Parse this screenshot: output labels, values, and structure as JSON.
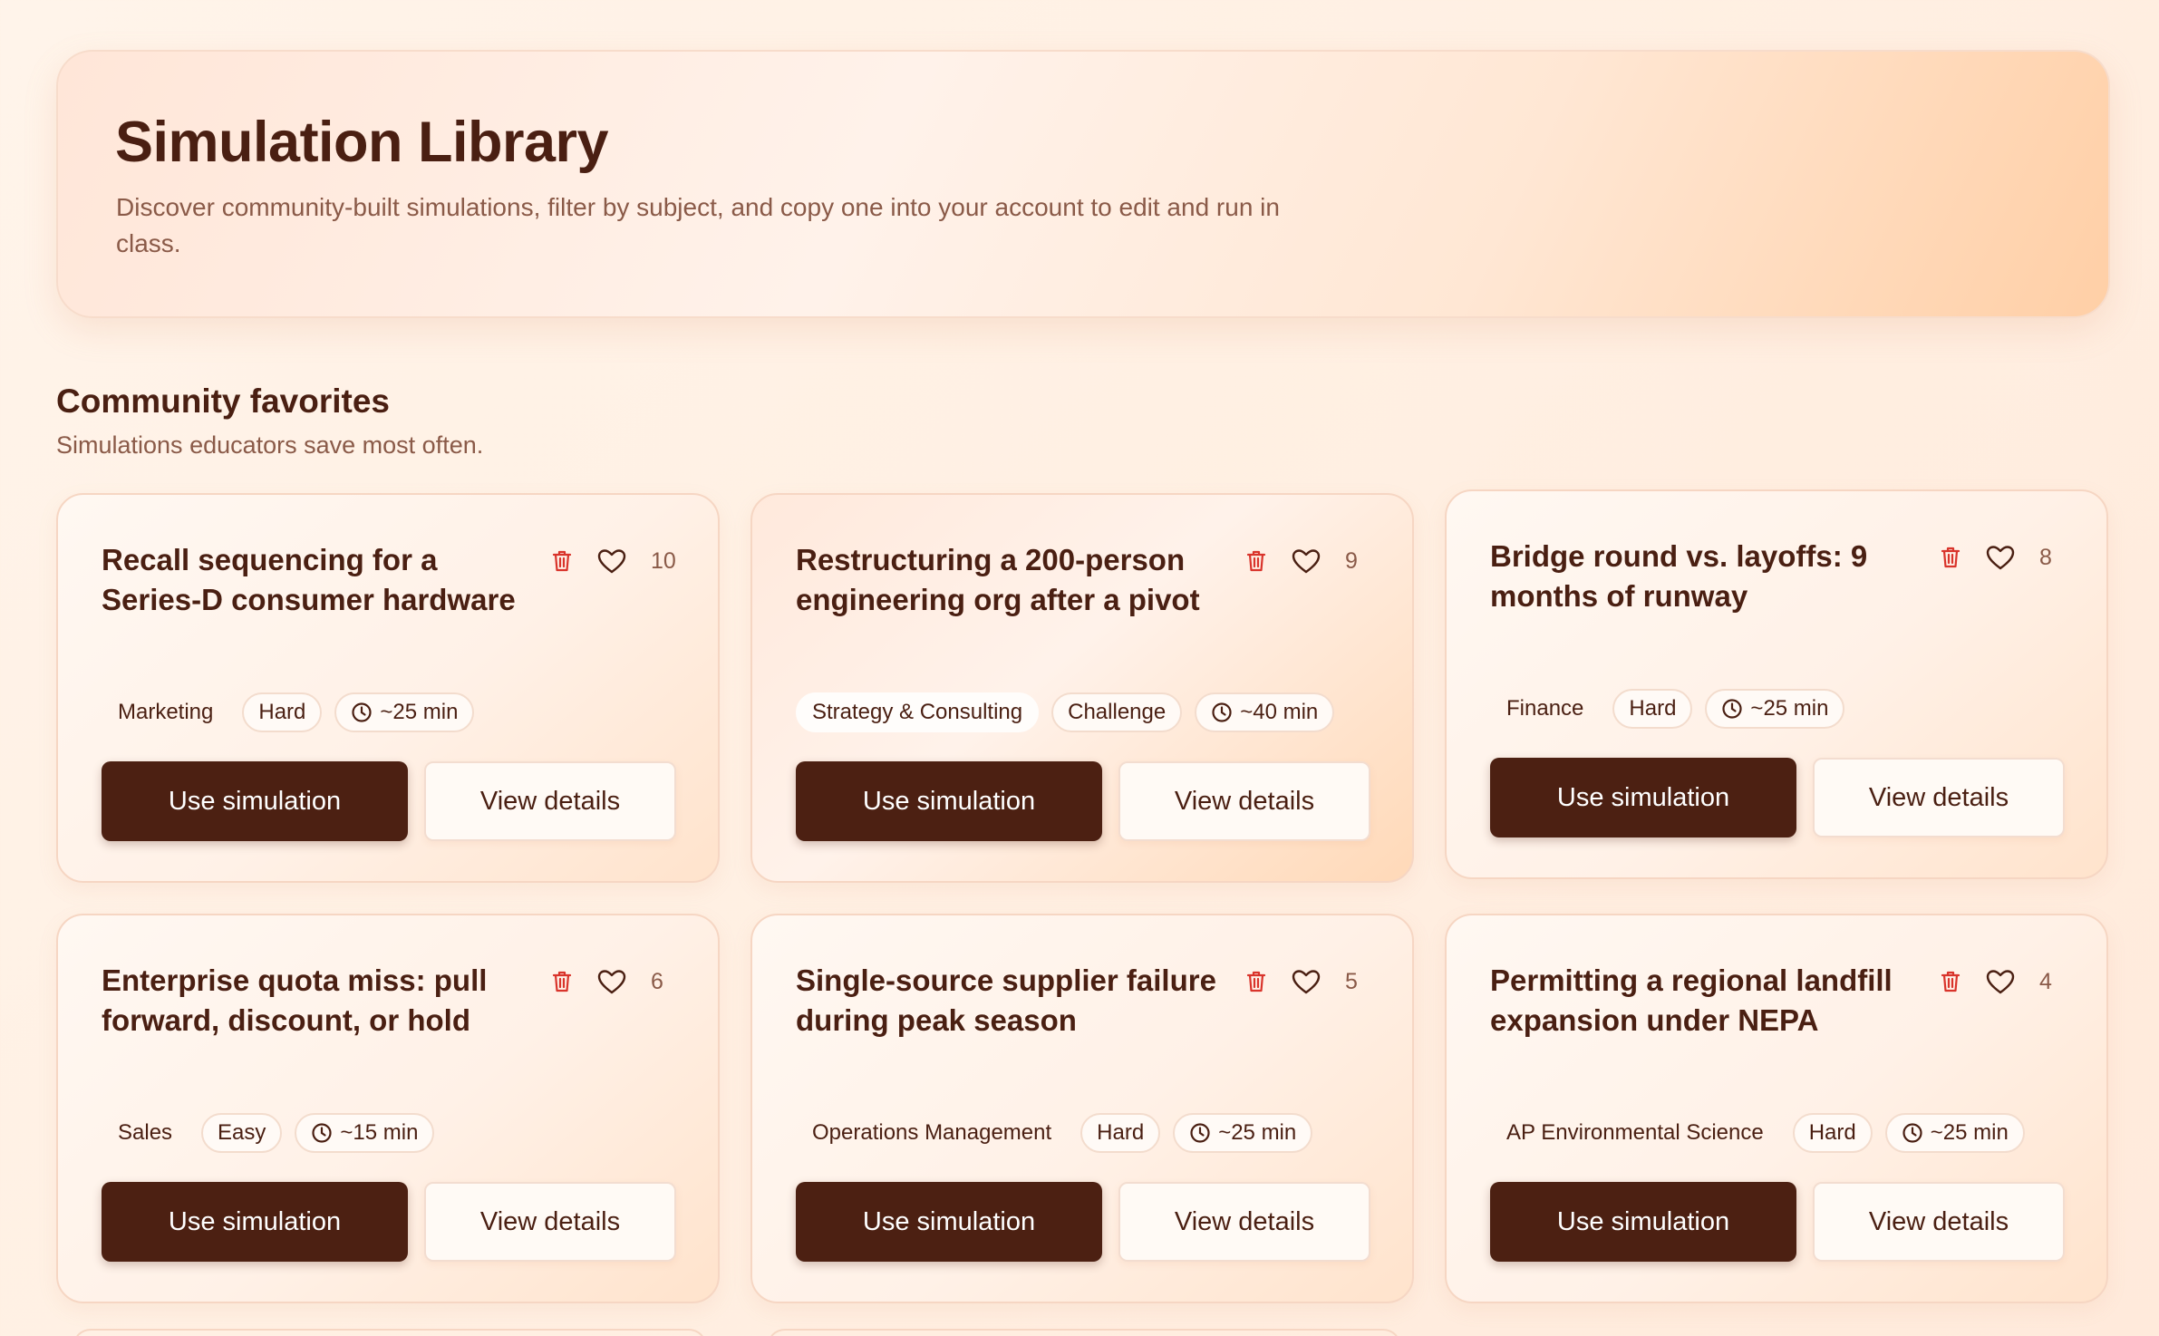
{
  "hero": {
    "title": "Simulation Library",
    "description": "Discover community-built simulations, filter by subject, and copy one into your account to edit and run in class."
  },
  "section": {
    "title": "Community favorites",
    "subtitle": "Simulations educators save most often."
  },
  "icons": {
    "delete": "trash-icon",
    "like": "heart-icon",
    "duration": "clock-icon"
  },
  "colors": {
    "primary_button": "#4c2012",
    "delete_icon": "#d9342b",
    "text_dark": "#4a1f12",
    "text_muted": "#8a5a48"
  },
  "cards": [
    {
      "title": "Recall sequencing for a Series-D consumer hardware",
      "likes": "10",
      "subject": "Marketing",
      "difficulty": "Hard",
      "duration": "~25 min",
      "primary_label": "Use simulation",
      "secondary_label": "View details"
    },
    {
      "title": "Restructuring a 200-person engineering org after a pivot",
      "likes": "9",
      "subject": "Strategy & Consulting",
      "difficulty": "Challenge",
      "duration": "~40 min",
      "primary_label": "Use simulation",
      "secondary_label": "View details"
    },
    {
      "title": "Bridge round vs. layoffs: 9 months of runway",
      "likes": "8",
      "subject": "Finance",
      "difficulty": "Hard",
      "duration": "~25 min",
      "primary_label": "Use simulation",
      "secondary_label": "View details"
    },
    {
      "title": "Enterprise quota miss: pull forward, discount, or hold",
      "likes": "6",
      "subject": "Sales",
      "difficulty": "Easy",
      "duration": "~15 min",
      "primary_label": "Use simulation",
      "secondary_label": "View details"
    },
    {
      "title": "Single-source supplier failure during peak season",
      "likes": "5",
      "subject": "Operations Management",
      "difficulty": "Hard",
      "duration": "~25 min",
      "primary_label": "Use simulation",
      "secondary_label": "View details"
    },
    {
      "title": "Permitting a regional landfill expansion under NEPA",
      "likes": "4",
      "subject": "AP Environmental Science",
      "difficulty": "Hard",
      "duration": "~25 min",
      "primary_label": "Use simulation",
      "secondary_label": "View details"
    }
  ]
}
